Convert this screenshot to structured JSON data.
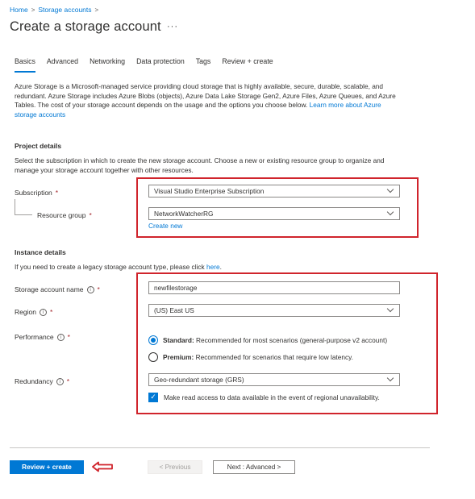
{
  "breadcrumb": {
    "home": "Home",
    "current": "Storage accounts",
    "sep": ">"
  },
  "page": {
    "title": "Create a storage account",
    "more": "···"
  },
  "tabs": [
    {
      "label": "Basics",
      "active": true
    },
    {
      "label": "Advanced"
    },
    {
      "label": "Networking"
    },
    {
      "label": "Data protection"
    },
    {
      "label": "Tags"
    },
    {
      "label": "Review + create"
    }
  ],
  "intro": {
    "text": "Azure Storage is a Microsoft-managed service providing cloud storage that is highly available, secure, durable, scalable, and redundant. Azure Storage includes Azure Blobs (objects), Azure Data Lake Storage Gen2, Azure Files, Azure Queues, and Azure Tables. The cost of your storage account depends on the usage and the options you choose below. ",
    "link": "Learn more about Azure storage accounts"
  },
  "project": {
    "title": "Project details",
    "desc": "Select the subscription in which to create the new storage account. Choose a new or existing resource group to organize and manage your storage account together with other resources.",
    "subscription_label": "Subscription",
    "subscription_value": "Visual Studio Enterprise Subscription",
    "rg_label": "Resource group",
    "rg_value": "NetworkWatcherRG",
    "create_new": "Create new"
  },
  "instance": {
    "title": "Instance details",
    "desc_pre": "If you need to create a legacy storage account type, please click ",
    "desc_link": "here",
    "desc_post": ".",
    "name_label": "Storage account name",
    "name_value": "newfilestorage",
    "region_label": "Region",
    "region_value": "(US) East US",
    "performance_label": "Performance",
    "standard_bold": "Standard:",
    "standard_text": " Recommended for most scenarios (general-purpose v2 account)",
    "premium_bold": "Premium:",
    "premium_text": " Recommended for scenarios that require low latency.",
    "redundancy_label": "Redundancy",
    "redundancy_value": "Geo-redundant storage (GRS)",
    "read_access": "Make read access to data available in the event of regional unavailability."
  },
  "required_mark": "*",
  "info_glyph": "i",
  "check_glyph": "✓",
  "footer": {
    "review": "Review + create",
    "previous": "< Previous",
    "next": "Next : Advanced >"
  },
  "colors": {
    "accent": "#0078d4",
    "highlight": "#d0242c"
  }
}
